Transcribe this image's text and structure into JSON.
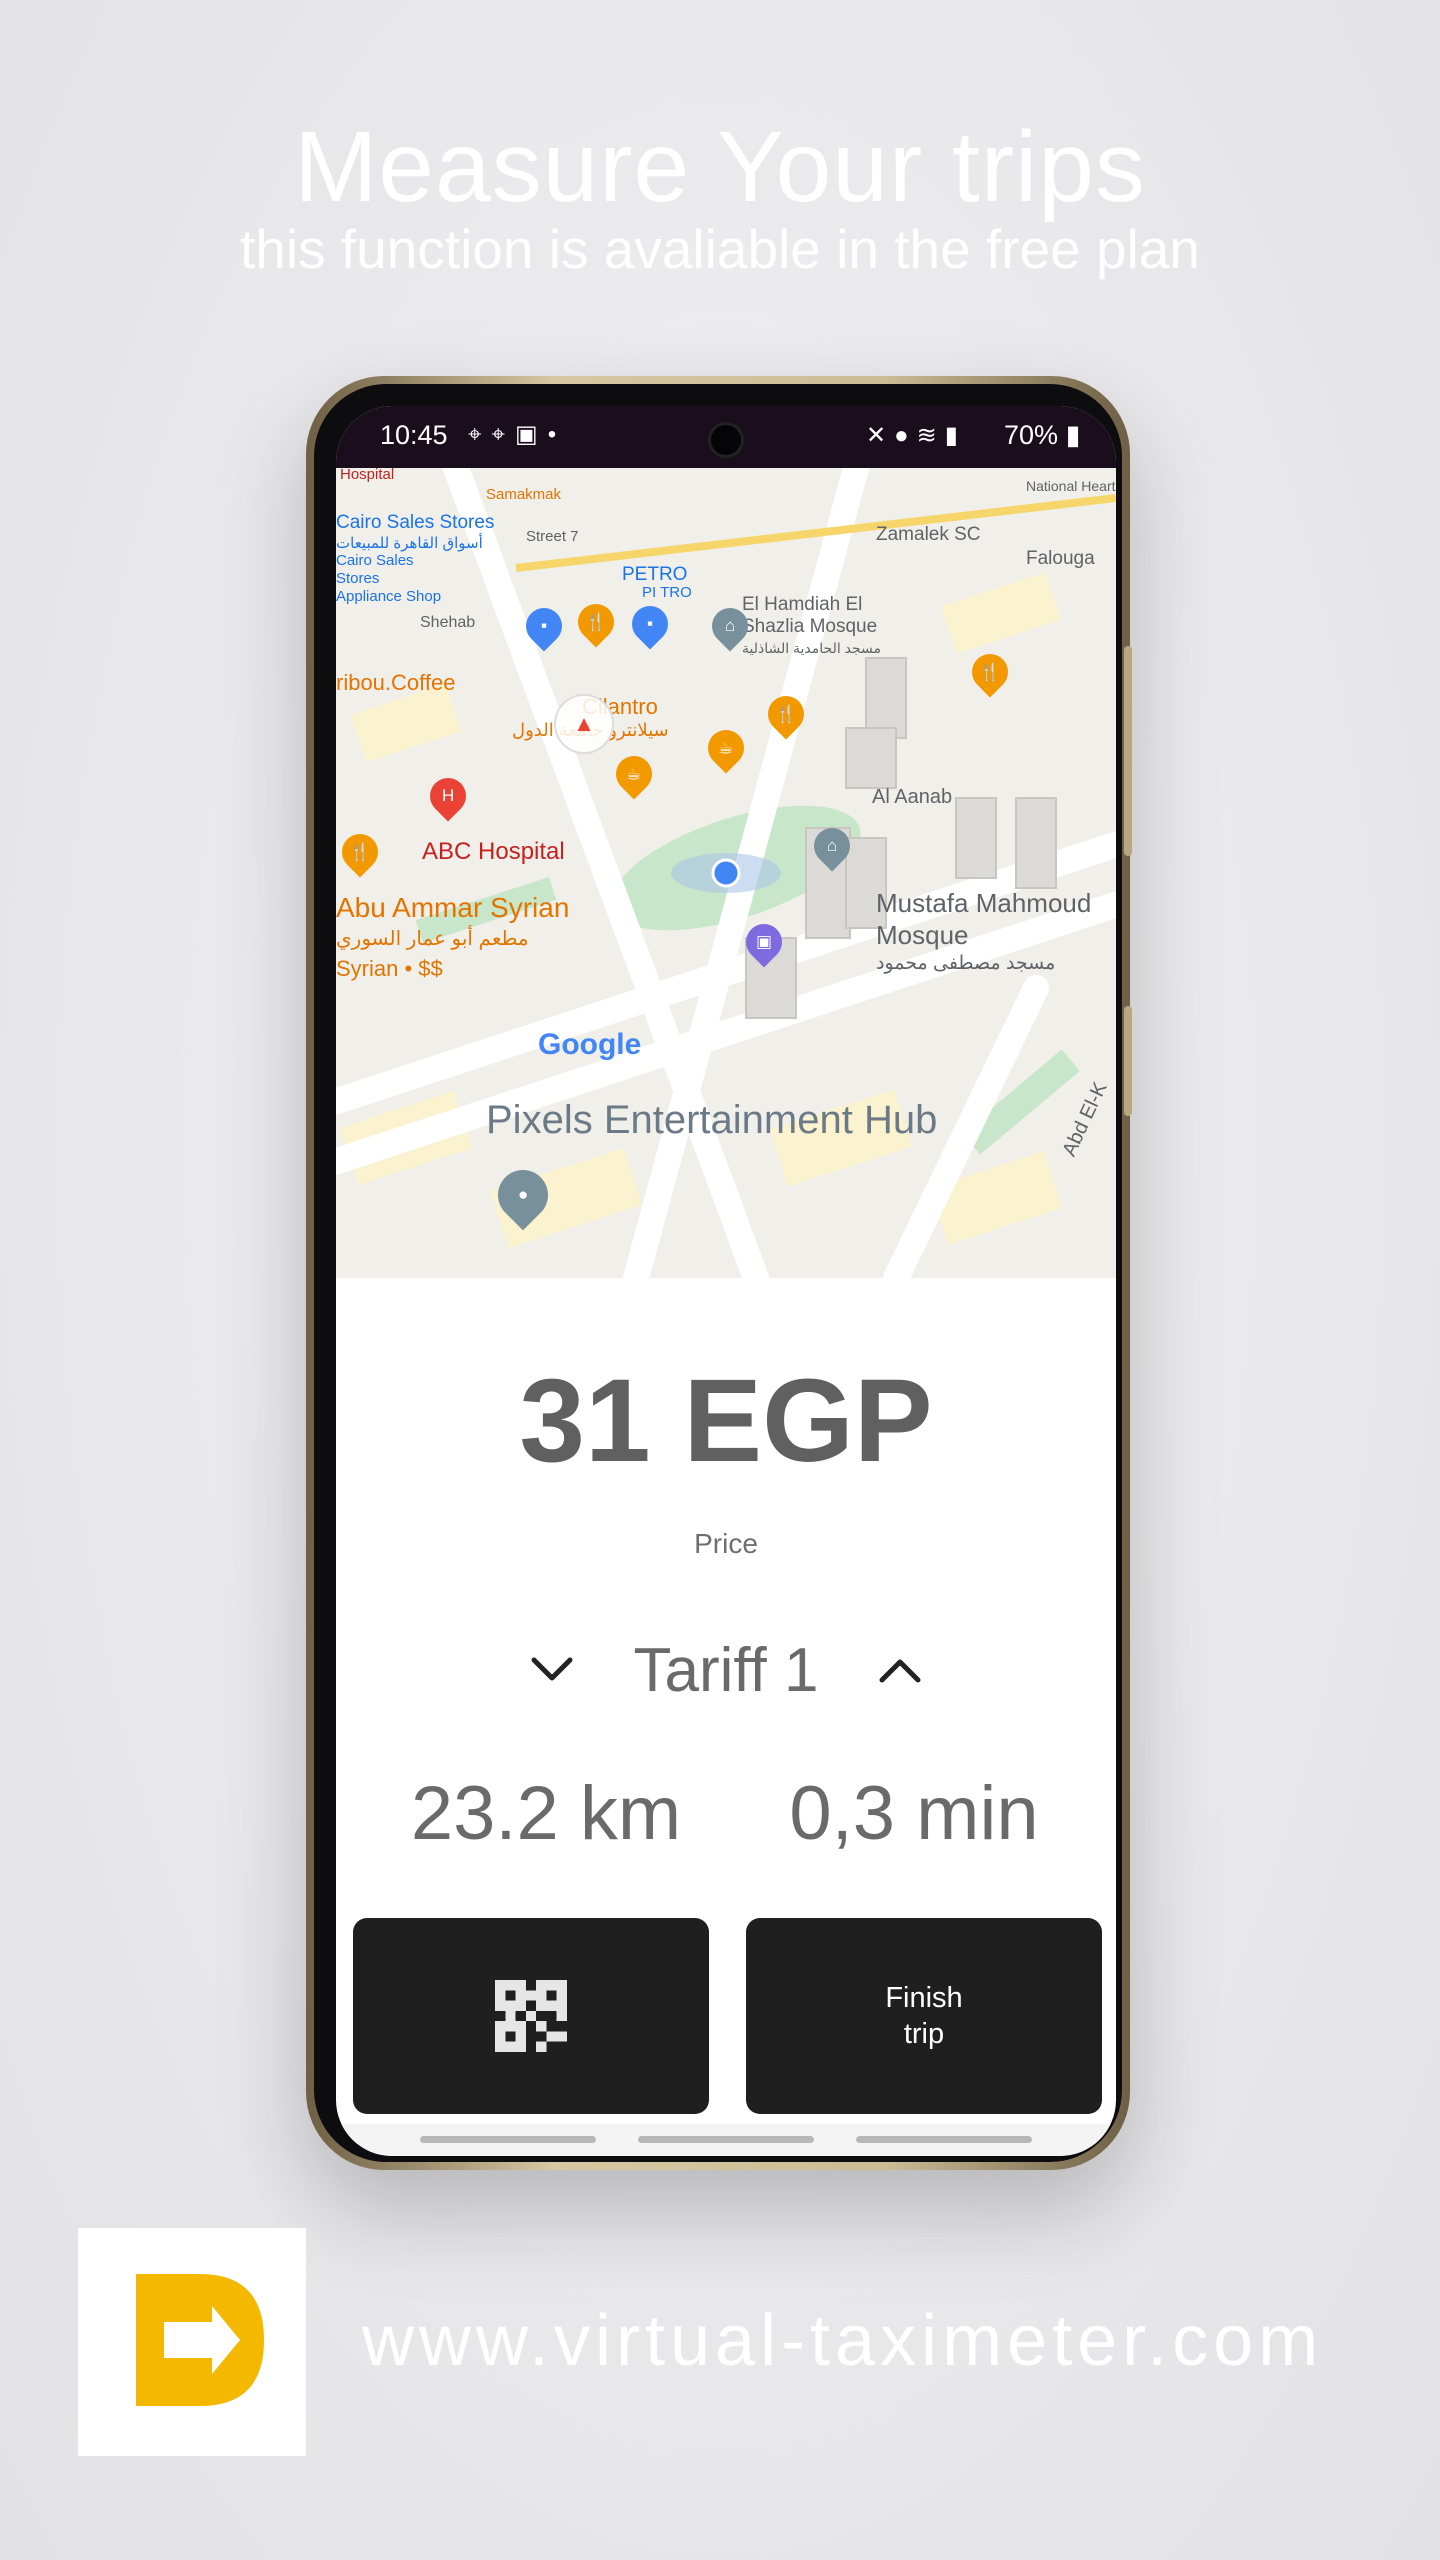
{
  "promo": {
    "headline": "Measure Your trips",
    "subline": "this function is avaliable in the free plan",
    "website": "www.virtual-taximeter.com"
  },
  "status_bar": {
    "time": "10:45",
    "battery": "70%",
    "left_icons": [
      "location-pin-icon",
      "location-pin-icon",
      "gallery-icon",
      "dot-icon"
    ],
    "right_icons": [
      "mute-icon",
      "location-icon",
      "wifi-icon",
      "signal-icon",
      "battery-icon"
    ]
  },
  "map": {
    "labels": {
      "cairo_sales": "Cairo Sales Stores",
      "cairo_sales_ar": "أسواق القاهرة للمبيعات",
      "appliance": "Cairo Sales Stores Appliance Shop",
      "samakmak": "Samakmak",
      "street7": "Street 7",
      "petro": "PETRO",
      "pi_tro": "PI TRO",
      "zamalek": "Zamalek SC",
      "falouga": "Falouga",
      "shehab": "Shehab",
      "el_hamdiah": "El Hamdiah El",
      "shazlia": "Shazlia Mosque",
      "shazlia_ar": "مسجد الحامدية الشاذلية",
      "caribou": "ribou.Coffee",
      "cilantro": "Cilantro",
      "cilantro_ar": "سيلانترو جامعة الدول",
      "al_aanab": "Al Aanab",
      "abc_hospital": "ABC Hospital",
      "mustafa": "Mustafa Mahmoud",
      "mosque": "Mosque",
      "mustafa_ar": "مسجد مصطفى محمود",
      "abu_ammar": "Abu Ammar Syrian",
      "abu_ammar_ar": "مطعم أبو عمار السوري",
      "syrian": "Syrian • $$",
      "google": "Google",
      "pixels": "Pixels Entertainment Hub",
      "abd_el": "Abd El-K",
      "hospital": "Hospital",
      "national_heart": "National Heart"
    }
  },
  "meter": {
    "price": "31 EGP",
    "price_label": "Price",
    "tariff": "Tariff 1",
    "distance": "23.2 km",
    "duration": "0,3 min"
  },
  "buttons": {
    "finish": "Finish\ntrip"
  },
  "colors": {
    "button_bg": "#1f1f1f",
    "logo_yellow": "#f5b800",
    "status_bar_bg": "#1a0e1c"
  }
}
